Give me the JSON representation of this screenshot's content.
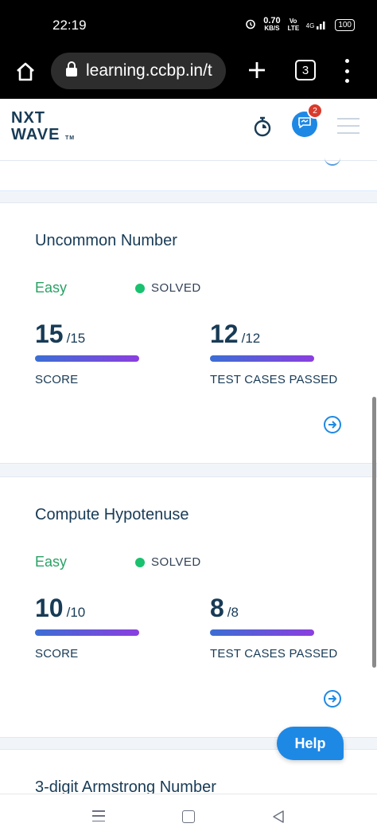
{
  "status_bar": {
    "time": "22:19",
    "net_speed": "0.70",
    "net_unit": "KB/S",
    "volte": "Vo LTE",
    "signal": "4G",
    "battery": "100"
  },
  "browser": {
    "url": "learning.ccbp.in/t",
    "tab_count": "3",
    "icons": [
      "home-icon",
      "lock-icon",
      "plus-icon",
      "tabs-icon",
      "more-icon"
    ]
  },
  "app_header": {
    "logo_line1": "NXT",
    "logo_line2": "WAVE",
    "logo_tm": "TM",
    "chat_badge": "2",
    "icons": [
      "timer-icon",
      "chat-icon",
      "hamburger-icon"
    ]
  },
  "problems": [
    {
      "title": "Uncommon Number",
      "difficulty": "Easy",
      "status": "SOLVED",
      "score": "15",
      "score_total": "/15",
      "score_label": "SCORE",
      "tests": "12",
      "tests_total": "/12",
      "tests_label": "TEST CASES PASSED"
    },
    {
      "title": "Compute Hypotenuse",
      "difficulty": "Easy",
      "status": "SOLVED",
      "score": "10",
      "score_total": "/10",
      "score_label": "SCORE",
      "tests": "8",
      "tests_total": "/8",
      "tests_label": "TEST CASES PASSED"
    },
    {
      "title": "3-digit Armstrong Number"
    }
  ],
  "help_label": "Help",
  "colors": {
    "primary_text": "#183b56",
    "easy_green": "#2aa165",
    "solved_dot": "#1ac16f",
    "accent_blue": "#1e88e5",
    "gradient_start": "#3b6ed4",
    "gradient_end": "#8b3ee0"
  }
}
